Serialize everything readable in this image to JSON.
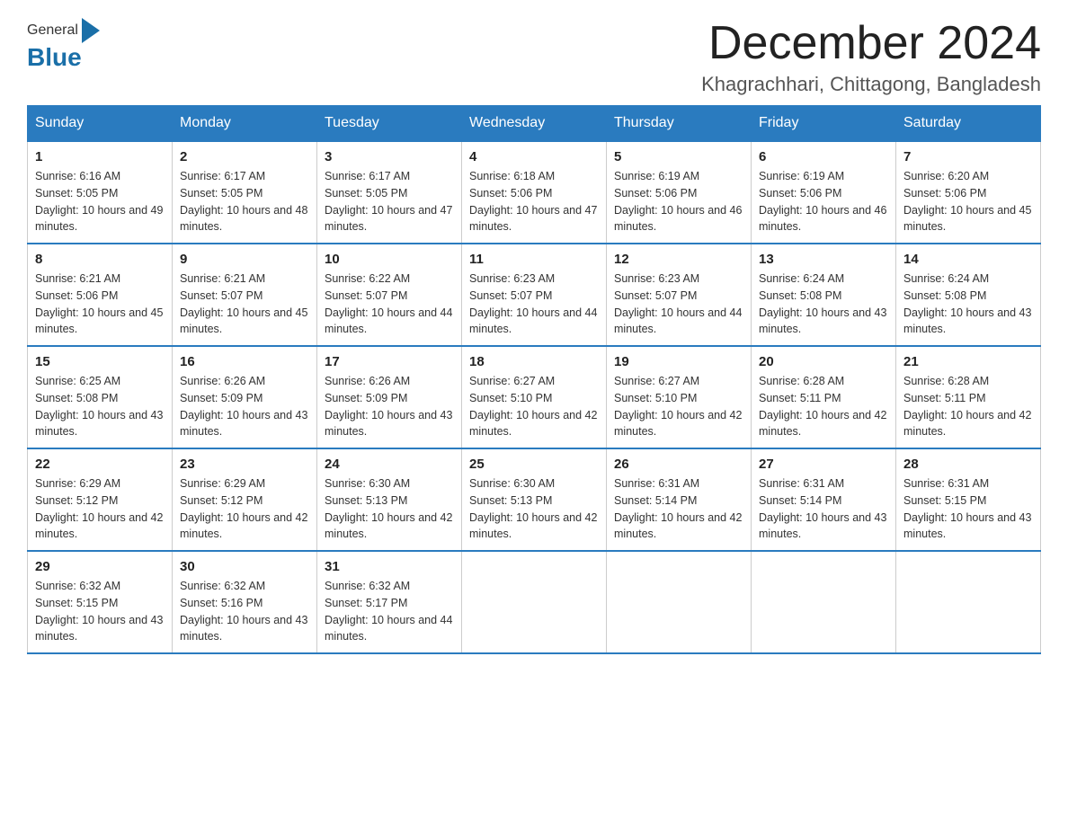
{
  "header": {
    "logo_general": "General",
    "logo_blue": "Blue",
    "month_title": "December 2024",
    "location": "Khagrachhari, Chittagong, Bangladesh"
  },
  "weekdays": [
    "Sunday",
    "Monday",
    "Tuesday",
    "Wednesday",
    "Thursday",
    "Friday",
    "Saturday"
  ],
  "weeks": [
    [
      {
        "day": "1",
        "sunrise": "6:16 AM",
        "sunset": "5:05 PM",
        "daylight": "10 hours and 49 minutes."
      },
      {
        "day": "2",
        "sunrise": "6:17 AM",
        "sunset": "5:05 PM",
        "daylight": "10 hours and 48 minutes."
      },
      {
        "day": "3",
        "sunrise": "6:17 AM",
        "sunset": "5:05 PM",
        "daylight": "10 hours and 47 minutes."
      },
      {
        "day": "4",
        "sunrise": "6:18 AM",
        "sunset": "5:06 PM",
        "daylight": "10 hours and 47 minutes."
      },
      {
        "day": "5",
        "sunrise": "6:19 AM",
        "sunset": "5:06 PM",
        "daylight": "10 hours and 46 minutes."
      },
      {
        "day": "6",
        "sunrise": "6:19 AM",
        "sunset": "5:06 PM",
        "daylight": "10 hours and 46 minutes."
      },
      {
        "day": "7",
        "sunrise": "6:20 AM",
        "sunset": "5:06 PM",
        "daylight": "10 hours and 45 minutes."
      }
    ],
    [
      {
        "day": "8",
        "sunrise": "6:21 AM",
        "sunset": "5:06 PM",
        "daylight": "10 hours and 45 minutes."
      },
      {
        "day": "9",
        "sunrise": "6:21 AM",
        "sunset": "5:07 PM",
        "daylight": "10 hours and 45 minutes."
      },
      {
        "day": "10",
        "sunrise": "6:22 AM",
        "sunset": "5:07 PM",
        "daylight": "10 hours and 44 minutes."
      },
      {
        "day": "11",
        "sunrise": "6:23 AM",
        "sunset": "5:07 PM",
        "daylight": "10 hours and 44 minutes."
      },
      {
        "day": "12",
        "sunrise": "6:23 AM",
        "sunset": "5:07 PM",
        "daylight": "10 hours and 44 minutes."
      },
      {
        "day": "13",
        "sunrise": "6:24 AM",
        "sunset": "5:08 PM",
        "daylight": "10 hours and 43 minutes."
      },
      {
        "day": "14",
        "sunrise": "6:24 AM",
        "sunset": "5:08 PM",
        "daylight": "10 hours and 43 minutes."
      }
    ],
    [
      {
        "day": "15",
        "sunrise": "6:25 AM",
        "sunset": "5:08 PM",
        "daylight": "10 hours and 43 minutes."
      },
      {
        "day": "16",
        "sunrise": "6:26 AM",
        "sunset": "5:09 PM",
        "daylight": "10 hours and 43 minutes."
      },
      {
        "day": "17",
        "sunrise": "6:26 AM",
        "sunset": "5:09 PM",
        "daylight": "10 hours and 43 minutes."
      },
      {
        "day": "18",
        "sunrise": "6:27 AM",
        "sunset": "5:10 PM",
        "daylight": "10 hours and 42 minutes."
      },
      {
        "day": "19",
        "sunrise": "6:27 AM",
        "sunset": "5:10 PM",
        "daylight": "10 hours and 42 minutes."
      },
      {
        "day": "20",
        "sunrise": "6:28 AM",
        "sunset": "5:11 PM",
        "daylight": "10 hours and 42 minutes."
      },
      {
        "day": "21",
        "sunrise": "6:28 AM",
        "sunset": "5:11 PM",
        "daylight": "10 hours and 42 minutes."
      }
    ],
    [
      {
        "day": "22",
        "sunrise": "6:29 AM",
        "sunset": "5:12 PM",
        "daylight": "10 hours and 42 minutes."
      },
      {
        "day": "23",
        "sunrise": "6:29 AM",
        "sunset": "5:12 PM",
        "daylight": "10 hours and 42 minutes."
      },
      {
        "day": "24",
        "sunrise": "6:30 AM",
        "sunset": "5:13 PM",
        "daylight": "10 hours and 42 minutes."
      },
      {
        "day": "25",
        "sunrise": "6:30 AM",
        "sunset": "5:13 PM",
        "daylight": "10 hours and 42 minutes."
      },
      {
        "day": "26",
        "sunrise": "6:31 AM",
        "sunset": "5:14 PM",
        "daylight": "10 hours and 42 minutes."
      },
      {
        "day": "27",
        "sunrise": "6:31 AM",
        "sunset": "5:14 PM",
        "daylight": "10 hours and 43 minutes."
      },
      {
        "day": "28",
        "sunrise": "6:31 AM",
        "sunset": "5:15 PM",
        "daylight": "10 hours and 43 minutes."
      }
    ],
    [
      {
        "day": "29",
        "sunrise": "6:32 AM",
        "sunset": "5:15 PM",
        "daylight": "10 hours and 43 minutes."
      },
      {
        "day": "30",
        "sunrise": "6:32 AM",
        "sunset": "5:16 PM",
        "daylight": "10 hours and 43 minutes."
      },
      {
        "day": "31",
        "sunrise": "6:32 AM",
        "sunset": "5:17 PM",
        "daylight": "10 hours and 44 minutes."
      },
      null,
      null,
      null,
      null
    ]
  ]
}
